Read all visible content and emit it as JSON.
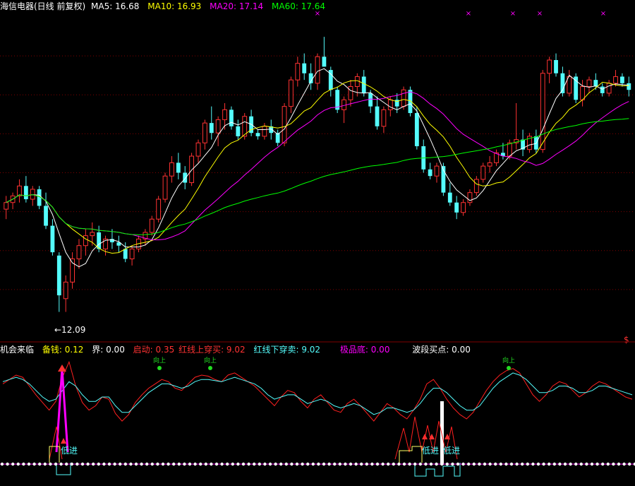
{
  "main_header": {
    "title": "海信电器(日线 前复权)",
    "ma5": "MA5: 16.68",
    "ma10": "MA10: 16.93",
    "ma20": "MA20: 17.14",
    "ma60": "MA60: 17.64"
  },
  "sub_header": {
    "name": "机会来临",
    "beiqian": "备钱: 0.12",
    "jie": "界: 0.00",
    "qidong": "启动: 0.35",
    "hongxian_up": "红线上穿买: 9.02",
    "hongxian_down": "红线下穿卖: 9.02",
    "jipindi": "极品底: 0.00",
    "boduan": "波段买点: 0.00"
  },
  "annotations": {
    "low_price": "←12.09",
    "signal_up": "向上",
    "signal_low": "低进",
    "dollar": "$"
  },
  "colors": {
    "up": "#ff3232",
    "down": "#54fcfc",
    "ma5": "#ffffff",
    "ma10": "#ffff00",
    "ma20": "#ff00ff",
    "ma60": "#00ff00",
    "grid": "#800000"
  },
  "chart_data": [
    {
      "type": "candlestick",
      "title": "海信电器(日线 前复权)",
      "ylim": [
        11.6,
        21.0
      ],
      "marked_low": 12.09,
      "series_names": [
        "MA5",
        "MA10",
        "MA20",
        "MA60"
      ],
      "candles": [
        [
          15.2,
          15.6,
          14.9,
          15.4
        ],
        [
          15.4,
          15.7,
          15.2,
          15.6
        ],
        [
          15.6,
          16.1,
          15.4,
          15.9
        ],
        [
          15.9,
          16.2,
          15.4,
          15.5
        ],
        [
          15.5,
          15.9,
          15.3,
          15.8
        ],
        [
          15.8,
          15.9,
          15.2,
          15.3
        ],
        [
          15.3,
          15.7,
          14.6,
          14.7
        ],
        [
          14.7,
          14.9,
          13.8,
          13.9
        ],
        [
          13.8,
          13.9,
          12.1,
          12.6
        ],
        [
          12.5,
          13.2,
          12.1,
          13.0
        ],
        [
          13.0,
          13.9,
          12.8,
          13.7
        ],
        [
          13.7,
          14.3,
          13.4,
          14.1
        ],
        [
          14.1,
          14.6,
          13.8,
          14.4
        ],
        [
          14.4,
          14.8,
          14.1,
          14.5
        ],
        [
          14.5,
          14.7,
          13.9,
          14.0
        ],
        [
          14.0,
          14.4,
          13.8,
          14.3
        ],
        [
          14.3,
          14.6,
          14.0,
          14.2
        ],
        [
          14.2,
          14.4,
          13.9,
          14.1
        ],
        [
          14.0,
          14.2,
          13.6,
          13.7
        ],
        [
          13.7,
          14.1,
          13.5,
          14.0
        ],
        [
          14.0,
          14.4,
          13.9,
          14.3
        ],
        [
          14.3,
          14.6,
          14.1,
          14.5
        ],
        [
          14.5,
          15.0,
          14.4,
          14.9
        ],
        [
          14.9,
          15.6,
          14.8,
          15.5
        ],
        [
          15.5,
          16.3,
          15.4,
          16.2
        ],
        [
          16.2,
          16.8,
          16.0,
          16.6
        ],
        [
          16.6,
          16.9,
          16.1,
          16.3
        ],
        [
          16.3,
          16.5,
          15.8,
          16.0
        ],
        [
          16.0,
          16.9,
          15.9,
          16.8
        ],
        [
          16.8,
          17.3,
          16.6,
          17.2
        ],
        [
          17.2,
          17.9,
          17.0,
          17.8
        ],
        [
          17.8,
          18.3,
          17.3,
          17.5
        ],
        [
          17.5,
          18.0,
          17.1,
          17.9
        ],
        [
          17.9,
          18.4,
          17.6,
          18.2
        ],
        [
          18.2,
          18.3,
          17.6,
          17.7
        ],
        [
          17.7,
          17.9,
          17.3,
          17.4
        ],
        [
          17.4,
          18.1,
          17.3,
          18.0
        ],
        [
          18.0,
          18.2,
          17.4,
          17.5
        ],
        [
          17.5,
          17.6,
          17.3,
          17.4
        ],
        [
          17.4,
          17.8,
          17.3,
          17.7
        ],
        [
          17.7,
          17.9,
          17.3,
          17.5
        ],
        [
          17.5,
          17.6,
          17.1,
          17.2
        ],
        [
          17.2,
          18.4,
          17.1,
          18.3
        ],
        [
          18.3,
          19.2,
          18.1,
          19.1
        ],
        [
          19.1,
          19.8,
          18.9,
          19.6
        ],
        [
          19.6,
          19.9,
          19.1,
          19.3
        ],
        [
          19.3,
          19.6,
          18.8,
          19.0
        ],
        [
          19.0,
          19.9,
          18.8,
          19.8
        ],
        [
          19.8,
          20.4,
          19.5,
          19.5
        ],
        [
          19.4,
          19.5,
          18.6,
          18.8
        ],
        [
          18.8,
          18.9,
          18.1,
          18.2
        ],
        [
          18.2,
          18.6,
          17.8,
          18.5
        ],
        [
          18.5,
          19.1,
          18.3,
          18.9
        ],
        [
          18.9,
          19.3,
          18.6,
          19.2
        ],
        [
          19.2,
          19.4,
          18.6,
          18.7
        ],
        [
          18.7,
          18.8,
          18.1,
          18.3
        ],
        [
          18.3,
          18.6,
          17.6,
          17.7
        ],
        [
          17.7,
          18.3,
          17.5,
          18.2
        ],
        [
          18.2,
          18.6,
          18.0,
          18.5
        ],
        [
          18.5,
          18.7,
          18.1,
          18.3
        ],
        [
          18.3,
          18.9,
          18.2,
          18.8
        ],
        [
          18.8,
          18.9,
          18.0,
          18.1
        ],
        [
          18.1,
          18.3,
          17.0,
          17.1
        ],
        [
          17.1,
          17.3,
          16.3,
          16.4
        ],
        [
          16.4,
          16.6,
          16.1,
          16.2
        ],
        [
          16.2,
          16.6,
          16.0,
          16.5
        ],
        [
          16.5,
          16.6,
          15.6,
          15.7
        ],
        [
          15.7,
          16.0,
          15.3,
          15.4
        ],
        [
          15.4,
          15.6,
          14.9,
          15.1
        ],
        [
          15.1,
          15.5,
          15.0,
          15.4
        ],
        [
          15.4,
          15.8,
          15.3,
          15.7
        ],
        [
          15.7,
          16.2,
          15.6,
          16.1
        ],
        [
          16.1,
          16.6,
          16.0,
          16.5
        ],
        [
          16.5,
          16.8,
          16.3,
          16.6
        ],
        [
          16.6,
          17.0,
          16.5,
          16.9
        ],
        [
          16.9,
          17.2,
          16.7,
          16.8
        ],
        [
          16.8,
          17.3,
          16.7,
          17.2
        ],
        [
          17.2,
          18.4,
          17.0,
          17.3
        ],
        [
          17.3,
          17.6,
          16.8,
          17.0
        ],
        [
          17.0,
          17.5,
          16.9,
          17.4
        ],
        [
          17.4,
          17.6,
          16.9,
          17.0
        ],
        [
          17.0,
          19.4,
          16.9,
          19.3
        ],
        [
          19.3,
          19.8,
          19.0,
          19.7
        ],
        [
          19.7,
          19.9,
          19.2,
          19.3
        ],
        [
          19.3,
          19.5,
          18.6,
          18.7
        ],
        [
          18.7,
          19.4,
          18.6,
          19.2
        ],
        [
          19.2,
          19.3,
          18.4,
          18.5
        ],
        [
          18.5,
          19.1,
          18.3,
          18.9
        ],
        [
          18.9,
          19.2,
          18.7,
          19.1
        ],
        [
          19.1,
          19.3,
          18.8,
          18.9
        ],
        [
          18.9,
          19.0,
          18.6,
          18.7
        ],
        [
          18.7,
          19.1,
          18.6,
          19.0
        ],
        [
          19.0,
          19.4,
          18.9,
          19.2
        ],
        [
          19.2,
          19.3,
          18.9,
          19.0
        ],
        [
          19.0,
          19.2,
          18.6,
          18.8
        ]
      ]
    },
    {
      "type": "line",
      "title": "机会来临",
      "ylim": [
        0,
        100
      ],
      "series": [
        {
          "name": "红线上穿买",
          "values": [
            72,
            76,
            80,
            78,
            70,
            62,
            55,
            48,
            56,
            78,
            92,
            70,
            55,
            48,
            52,
            60,
            58,
            45,
            38,
            44,
            55,
            62,
            68,
            72,
            76,
            74,
            68,
            66,
            72,
            78,
            80,
            79,
            76,
            74,
            80,
            82,
            78,
            74,
            70,
            64,
            58,
            52,
            60,
            66,
            64,
            56,
            50,
            58,
            62,
            55,
            48,
            46,
            54,
            58,
            52,
            45,
            38,
            46,
            54,
            50,
            44,
            40,
            48,
            58,
            72,
            76,
            68,
            58,
            50,
            44,
            40,
            46,
            56,
            66,
            74,
            80,
            84,
            86,
            82,
            72,
            62,
            56,
            62,
            70,
            74,
            72,
            66,
            60,
            64,
            70,
            74,
            72,
            68,
            64,
            60,
            58
          ]
        },
        {
          "name": "红线下穿卖",
          "values": [
            74,
            76,
            78,
            76,
            72,
            66,
            60,
            56,
            58,
            66,
            74,
            70,
            62,
            56,
            56,
            60,
            60,
            52,
            46,
            46,
            52,
            58,
            64,
            68,
            72,
            72,
            70,
            68,
            70,
            74,
            76,
            76,
            75,
            74,
            76,
            78,
            76,
            74,
            72,
            68,
            62,
            58,
            60,
            62,
            62,
            58,
            54,
            56,
            58,
            56,
            52,
            50,
            52,
            54,
            52,
            48,
            44,
            46,
            50,
            50,
            48,
            46,
            48,
            54,
            62,
            68,
            68,
            64,
            58,
            52,
            48,
            48,
            52,
            60,
            68,
            74,
            78,
            82,
            80,
            76,
            70,
            64,
            64,
            66,
            70,
            70,
            68,
            64,
            64,
            66,
            70,
            70,
            68,
            66,
            64,
            62
          ]
        }
      ]
    }
  ]
}
